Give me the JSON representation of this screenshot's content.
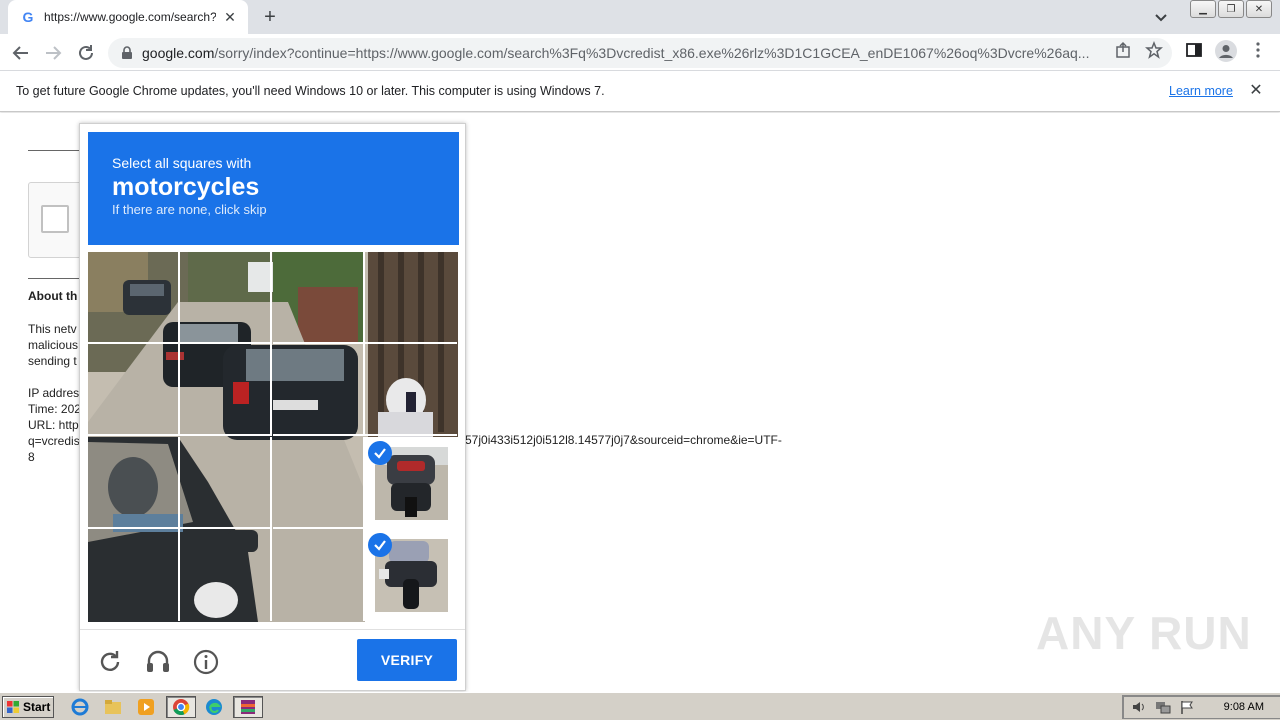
{
  "browser": {
    "tab": {
      "title": "https://www.google.com/search?q="
    },
    "address": {
      "domain": "google.com",
      "path": "/sorry/index?continue=https://www.google.com/search%3Fq%3Dvcredist_x86.exe%26rlz%3D1C1GCEA_enDE1067%26oq%3Dvcre%26aq..."
    },
    "infobar": {
      "message": "To get future Google Chrome updates, you'll need Windows 10 or later. This computer is using Windows 7.",
      "link": "Learn more"
    }
  },
  "page": {
    "about_heading": "About th",
    "para_lines": [
      "This netv",
      "malicious",
      "sending t"
    ],
    "info_lines": [
      "IP addres",
      "Time: 202",
      "URL: http",
      "q=vcredis",
      "8"
    ],
    "url_tail": "57j0i433i512j0i512l8.14577j0j7&sourceid=chrome&ie=UTF-"
  },
  "captcha": {
    "instruction": "Select all squares with",
    "keyword": "motorcycles",
    "hint": "If there are none, click skip",
    "verify_label": "VERIFY",
    "selected_tiles": [
      [
        2,
        3
      ],
      [
        3,
        3
      ]
    ]
  },
  "watermark": "ANY RUN",
  "taskbar": {
    "start_label": "Start",
    "clock": "9:08 AM"
  },
  "colors": {
    "accent": "#1a73e8"
  }
}
